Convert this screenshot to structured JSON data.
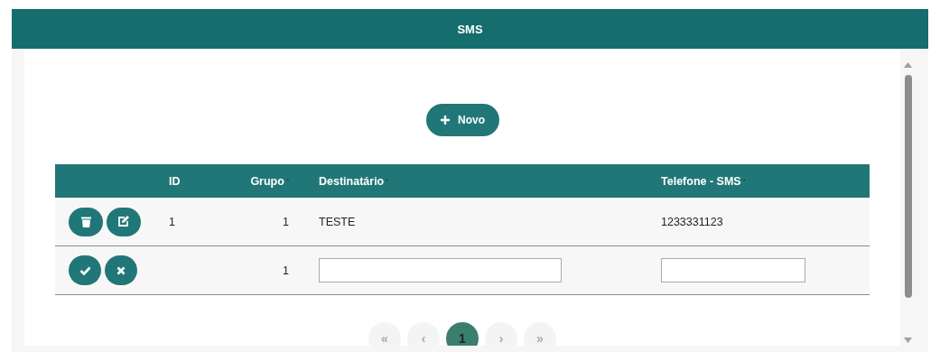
{
  "window": {
    "title": "SMS"
  },
  "new_button": {
    "label": "Novo"
  },
  "table": {
    "columns": [
      {
        "label": "ID"
      },
      {
        "label": "Grupo",
        "required_mark": "*"
      },
      {
        "label": "Destinatário",
        "required_mark": "*"
      },
      {
        "label": "Telefone - SMS",
        "required_mark": "*"
      }
    ],
    "rows": [
      {
        "kind": "record",
        "actions": [
          {
            "kind": "delete"
          },
          {
            "kind": "edit"
          }
        ],
        "id": "1",
        "grupo": "1",
        "destinatario": "TESTE",
        "telefone": "1233331123"
      },
      {
        "kind": "edit",
        "actions": [
          {
            "kind": "confirm"
          },
          {
            "kind": "cancel"
          }
        ],
        "grupo": "1"
      }
    ]
  },
  "pagination": [
    {
      "label": "«",
      "selected": false
    },
    {
      "label": "‹",
      "selected": false
    },
    {
      "label": "1",
      "selected": true
    },
    {
      "label": "›",
      "selected": false
    },
    {
      "label": "»",
      "selected": false
    }
  ]
}
